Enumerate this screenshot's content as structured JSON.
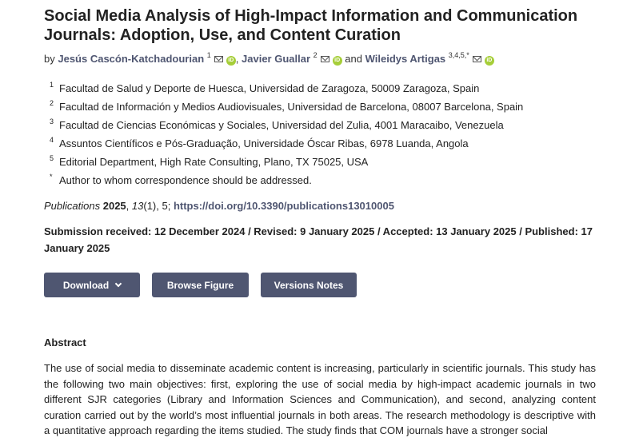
{
  "article": {
    "title": "Social Media Analysis of High-Impact Information and Communication Journals: Adoption, Use, and Content Curation",
    "by": "by",
    "authors": [
      {
        "name": "Jesús Cascón-Katchadourian",
        "sup": "1"
      },
      {
        "name": "Javier Guallar",
        "sup": "2"
      },
      {
        "name": "Wileidys Artigas",
        "sup": "3,4,5,*"
      }
    ],
    "and": "and",
    "affiliations": [
      {
        "num": "1",
        "text": "Facultad de Salud y Deporte de Huesca, Universidad de Zaragoza, 50009 Zaragoza, Spain"
      },
      {
        "num": "2",
        "text": "Facultad de Información y Medios Audiovisuales, Universidad de Barcelona, 08007 Barcelona, Spain"
      },
      {
        "num": "3",
        "text": "Facultad de Ciencias Económicas y Sociales, Universidad del Zulia, 4001 Maracaibo, Venezuela"
      },
      {
        "num": "4",
        "text": "Assuntos Científicos e Pós-Graduação, Universidade Óscar Ribas, 6978 Luanda, Angola"
      },
      {
        "num": "5",
        "text": "Editorial Department, High Rate Consulting, Plano, TX 75025, USA"
      },
      {
        "num": "*",
        "text": "Author to whom correspondence should be addressed."
      }
    ],
    "citation": {
      "journal": "Publications",
      "year": "2025",
      "volume": "13",
      "issue": "(1), 5;",
      "doi": "https://doi.org/10.3390/publications13010005"
    },
    "dates": "Submission received: 12 December 2024 / Revised: 9 January 2025 / Accepted: 13 January 2025 / Published: 17 January 2025",
    "buttons": {
      "download": "Download",
      "browse_figure": "Browse Figure",
      "versions_notes": "Versions Notes"
    },
    "abstract_heading": "Abstract",
    "abstract": "The use of social media to disseminate academic content is increasing, particularly in scientific journals. This study has the following two main objectives: first, exploring the use of social media by high-impact academic journals in two different SJR categories (Library and Information Sciences and Communication), and second, analyzing content curation carried out by the world’s most influential journals in both areas. The research methodology is descriptive with a quantitative approach regarding the items studied. The study finds that COM journals have a stronger social"
  },
  "icons": {
    "email": "email-icon",
    "orcid": "orcid-icon",
    "orcid_text": "iD"
  },
  "colors": {
    "accent": "#4f5671",
    "orcid": "#a6ce39"
  }
}
